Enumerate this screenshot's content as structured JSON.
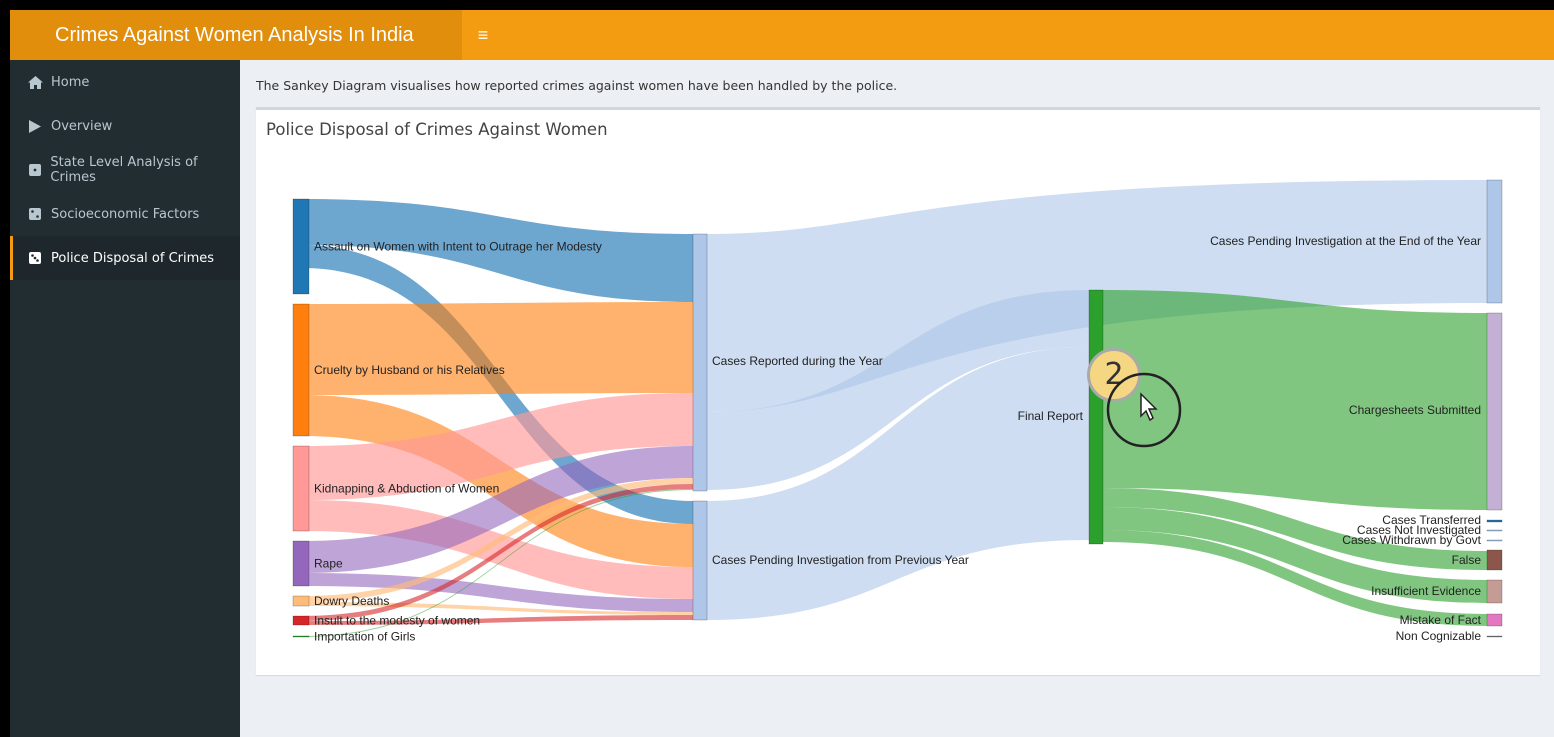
{
  "app": {
    "title": "Crimes Against Women Analysis In India",
    "menu_toggle_icon": "hamburger-icon"
  },
  "sidebar": {
    "items": [
      {
        "label": "Home",
        "icon": "home-icon"
      },
      {
        "label": "Overview",
        "icon": "play-icon"
      },
      {
        "label": "State Level Analysis of Crimes",
        "icon": "dice-icon"
      },
      {
        "label": "Socioeconomic Factors",
        "icon": "dice-icon"
      },
      {
        "label": "Police Disposal of Crimes",
        "icon": "dice-icon",
        "active": true
      }
    ]
  },
  "main": {
    "description": "The Sankey Diagram visualises how reported crimes against women have been handled by the police.",
    "box_title": "Police Disposal of Crimes Against Women"
  },
  "sankey": {
    "crime_nodes": [
      {
        "label": "Assault on Women with Intent to Outrage her Modesty",
        "color": "#1f77b4"
      },
      {
        "label": "Cruelty by Husband or his Relatives",
        "color": "#ff7f0e"
      },
      {
        "label": "Kidnapping & Abduction of Women",
        "color": "#ff9896"
      },
      {
        "label": "Rape",
        "color": "#9467bd"
      },
      {
        "label": "Dowry Deaths",
        "color": "#ffbb78"
      },
      {
        "label": "Insult to the modesty of women",
        "color": "#d62728"
      },
      {
        "label": "Importation of Girls",
        "color": "#2ca02c"
      }
    ],
    "stage_nodes": [
      {
        "label": "Cases Reported during the Year",
        "color": "#aec7e8"
      },
      {
        "label": "Cases Pending Investigation from Previous Year",
        "color": "#aec7e8"
      },
      {
        "label": "Final Report",
        "color": "#2ca02c"
      }
    ],
    "outcome_nodes": [
      {
        "label": "Cases Pending Investigation at the End of the Year",
        "color": "#aec7e8"
      },
      {
        "label": "Chargesheets Submitted",
        "color": "#c5b0d5"
      },
      {
        "label": "Cases Transferred",
        "color": "#1f77b4"
      },
      {
        "label": "Cases Not Investigated",
        "color": "#aec7e8"
      },
      {
        "label": "Cases Withdrawn by Govt",
        "color": "#aec7e8"
      },
      {
        "label": "False",
        "color": "#8c564b"
      },
      {
        "label": "Insufficient Evidence",
        "color": "#c49c94"
      },
      {
        "label": "Mistake of Fact",
        "color": "#e377c2"
      },
      {
        "label": "Non Cognizable",
        "color": "#7f7f7f"
      }
    ]
  },
  "cursor": {
    "step": "2",
    "icon": "mouse-pointer-icon"
  }
}
